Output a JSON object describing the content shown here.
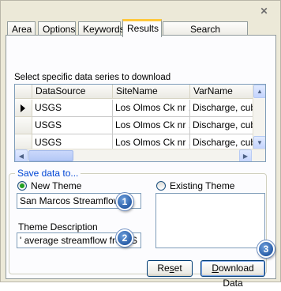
{
  "window": {
    "close_glyph": "✕"
  },
  "tabs": [
    {
      "label": "Area"
    },
    {
      "label": "Options"
    },
    {
      "label": "Keywords"
    },
    {
      "label": "Results"
    },
    {
      "label": "Search Management"
    }
  ],
  "results": {
    "instruction": "Select specific data series to download",
    "columns": [
      "DataSource",
      "SiteName",
      "VarName"
    ],
    "rows": [
      {
        "source": "USGS",
        "site": "Los Olmos Ck nr ...",
        "var": "Discharge, cubic",
        "selected": true
      },
      {
        "source": "USGS",
        "site": "Los Olmos Ck nr ...",
        "var": "Discharge, cubic",
        "selected": false
      },
      {
        "source": "USGS",
        "site": "Los Olmos Ck nr ...",
        "var": "Discharge, cubic",
        "selected": false
      }
    ]
  },
  "save": {
    "group_label": "Save data to...",
    "new_theme_label": "New Theme",
    "existing_theme_label": "Existing Theme",
    "new_theme_selected": true,
    "theme_name_value": "San Marcos Streamflow",
    "theme_description_label": "Theme Description",
    "theme_description_value": "' average streamflow from S"
  },
  "badges": [
    "1",
    "2",
    "3"
  ],
  "buttons": {
    "reset_pre": "Re",
    "reset_ul": "s",
    "reset_post": "et",
    "download_ul": "D",
    "download_post": "ownload Data"
  },
  "colors": {
    "active_tab_accent": "#ffc83c",
    "group_label": "#0046d5",
    "radio_selected": "#21a121",
    "badge": "#2a5ea8"
  }
}
